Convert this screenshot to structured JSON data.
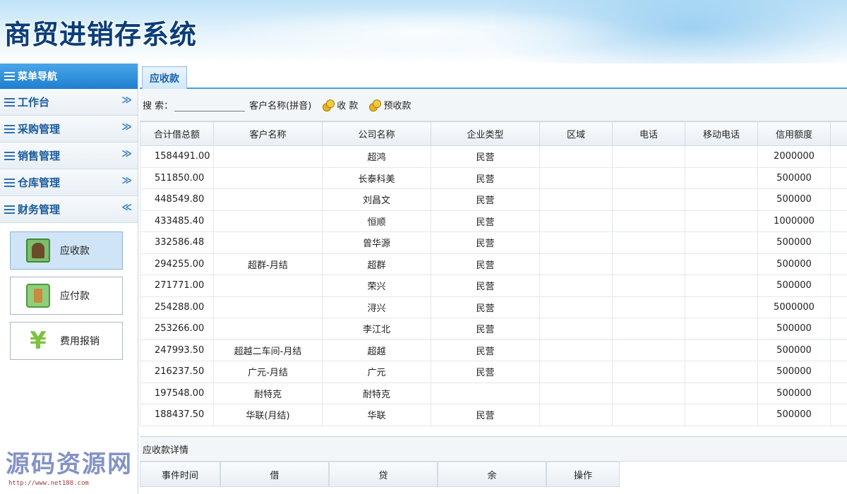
{
  "app": {
    "title": "商贸进销存系统"
  },
  "sidebar": {
    "header": "菜单导航",
    "items": [
      {
        "label": "工作台",
        "chevron": "≫"
      },
      {
        "label": "采购管理",
        "chevron": "≫"
      },
      {
        "label": "销售管理",
        "chevron": "≫"
      },
      {
        "label": "仓库管理",
        "chevron": "≫"
      },
      {
        "label": "财务管理",
        "chevron": "≪"
      }
    ],
    "finance_buttons": [
      {
        "label": "应收款",
        "icon": "money-icon"
      },
      {
        "label": "应付款",
        "icon": "wallet-icon"
      },
      {
        "label": "费用报销",
        "icon": "yen-icon",
        "glyph": "¥"
      }
    ]
  },
  "tabs": [
    {
      "label": "应收款"
    }
  ],
  "toolbar": {
    "search_label": "搜 索：",
    "search_value": "",
    "search_hint": "客户名称(拼音)",
    "collect_label": "收 款",
    "precollect_label": "预收款"
  },
  "table": {
    "columns": [
      "合计借总额",
      "客户名称",
      "公司名称",
      "企业类型",
      "区域",
      "电话",
      "移动电话",
      "信用额度"
    ],
    "rows": [
      [
        "1584491.00",
        "",
        "超鸿",
        "民营",
        "",
        "",
        "",
        "2000000"
      ],
      [
        "511850.00",
        "",
        "长泰科美",
        "民营",
        "",
        "",
        "",
        "500000"
      ],
      [
        "448549.80",
        "",
        "刘昌文",
        "民营",
        "",
        "",
        "",
        "500000"
      ],
      [
        "433485.40",
        "",
        "恒顺",
        "民营",
        "",
        "",
        "",
        "1000000"
      ],
      [
        "332586.48",
        "",
        "曾华源",
        "民营",
        "",
        "",
        "",
        "500000"
      ],
      [
        "294255.00",
        "超群-月结",
        "超群",
        "民营",
        "",
        "",
        "",
        "500000"
      ],
      [
        "271771.00",
        "",
        "荣兴",
        "民营",
        "",
        "",
        "",
        "500000"
      ],
      [
        "254288.00",
        "",
        "浔兴",
        "民营",
        "",
        "",
        "",
        "5000000"
      ],
      [
        "253266.00",
        "",
        "李江北",
        "民营",
        "",
        "",
        "",
        "500000"
      ],
      [
        "247993.50",
        "超越二车间-月结",
        "超越",
        "民营",
        "",
        "",
        "",
        "500000"
      ],
      [
        "216237.50",
        "广元-月结",
        "广元",
        "民营",
        "",
        "",
        "",
        "500000"
      ],
      [
        "197548.00",
        "耐特克",
        "耐特克",
        "",
        "",
        "",
        "",
        "500000"
      ],
      [
        "188437.50",
        "华联(月结)",
        "华联",
        "民营",
        "",
        "",
        "",
        "500000"
      ]
    ]
  },
  "detail": {
    "title": "应收款详情",
    "columns": [
      "事件时间",
      "借",
      "贷",
      "余",
      "操作"
    ]
  },
  "watermark": {
    "text": "源码资源网",
    "url": "http://www.net188.com"
  }
}
